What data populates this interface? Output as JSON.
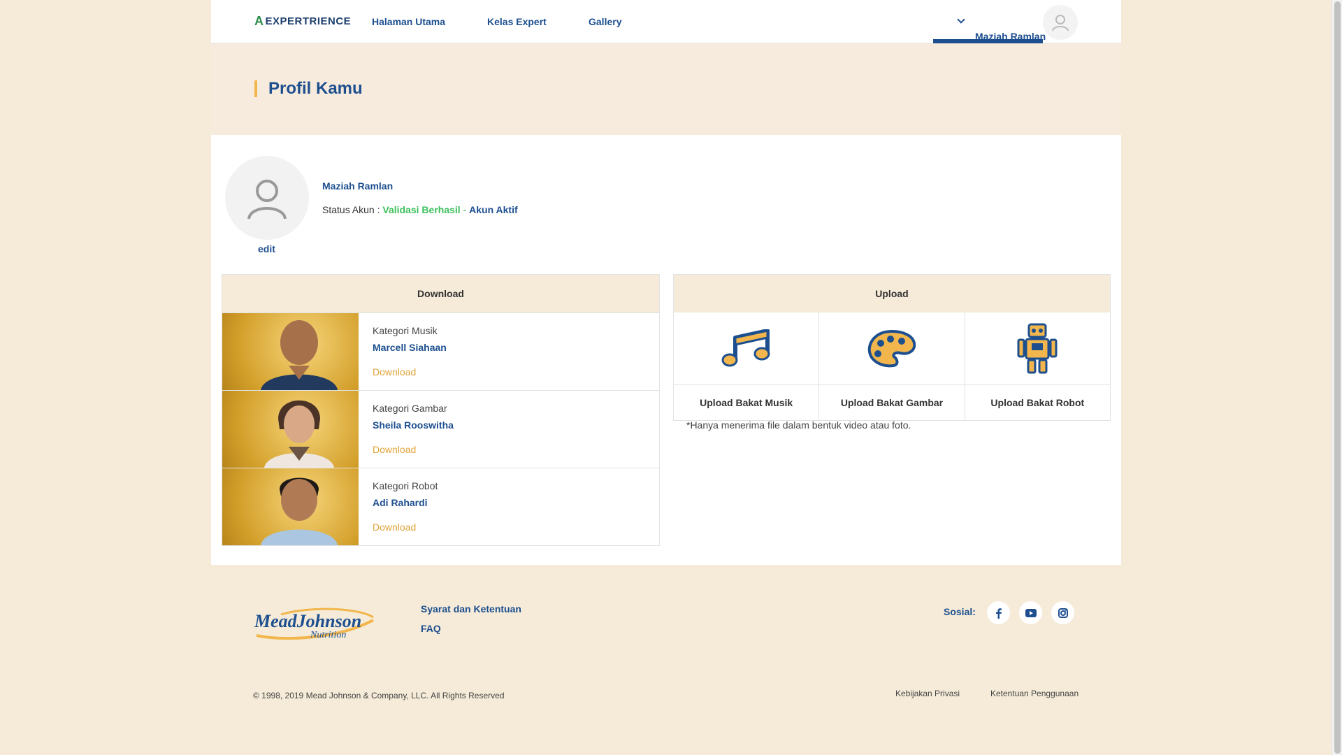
{
  "header": {
    "logo_text": "EXPERTRIENCE",
    "nav": [
      "Halaman Utama",
      "Kelas Expert",
      "Gallery"
    ],
    "user_name": "Maziah Ramlan"
  },
  "banner": {
    "title": "Profil Kamu"
  },
  "profile": {
    "edit_label": "edit",
    "name": "Maziah Ramlan",
    "status_label": "Status Akun :",
    "status_validated": "Validasi Berhasil",
    "status_sep": "-",
    "status_active": "Akun Aktif"
  },
  "download": {
    "header": "Download",
    "items": [
      {
        "category": "Kategori Musik",
        "name": "Marcell Siahaan",
        "link": "Download"
      },
      {
        "category": "Kategori Gambar",
        "name": "Sheila Rooswitha",
        "link": "Download"
      },
      {
        "category": "Kategori Robot",
        "name": "Adi Rahardi",
        "link": "Download"
      }
    ]
  },
  "upload": {
    "header": "Upload",
    "items": [
      {
        "label": "Upload Bakat Musik",
        "icon": "music-note-icon"
      },
      {
        "label": "Upload Bakat Gambar",
        "icon": "paint-palette-icon"
      },
      {
        "label": "Upload Bakat Robot",
        "icon": "robot-icon"
      }
    ],
    "note": "*Hanya menerima file dalam bentuk video atau foto."
  },
  "footer": {
    "brand_line1": "MeadJohnson",
    "brand_line2": "Nutrition",
    "links": [
      "Syarat dan Ketentuan",
      "FAQ"
    ],
    "social_label": "Sosial:",
    "social": [
      "facebook-icon",
      "youtube-icon",
      "instagram-icon"
    ],
    "copyright": "© 1998, 2019 Mead Johnson & Company, LLC. All Rights Reserved",
    "legal": [
      "Kebijakan Privasi",
      "Ketentuan Penggunaan"
    ]
  },
  "colors": {
    "brand_blue": "#1d4f8f",
    "accent_gold": "#e0a43a",
    "success_green": "#3cc05c",
    "cream": "#f5ebd8"
  }
}
